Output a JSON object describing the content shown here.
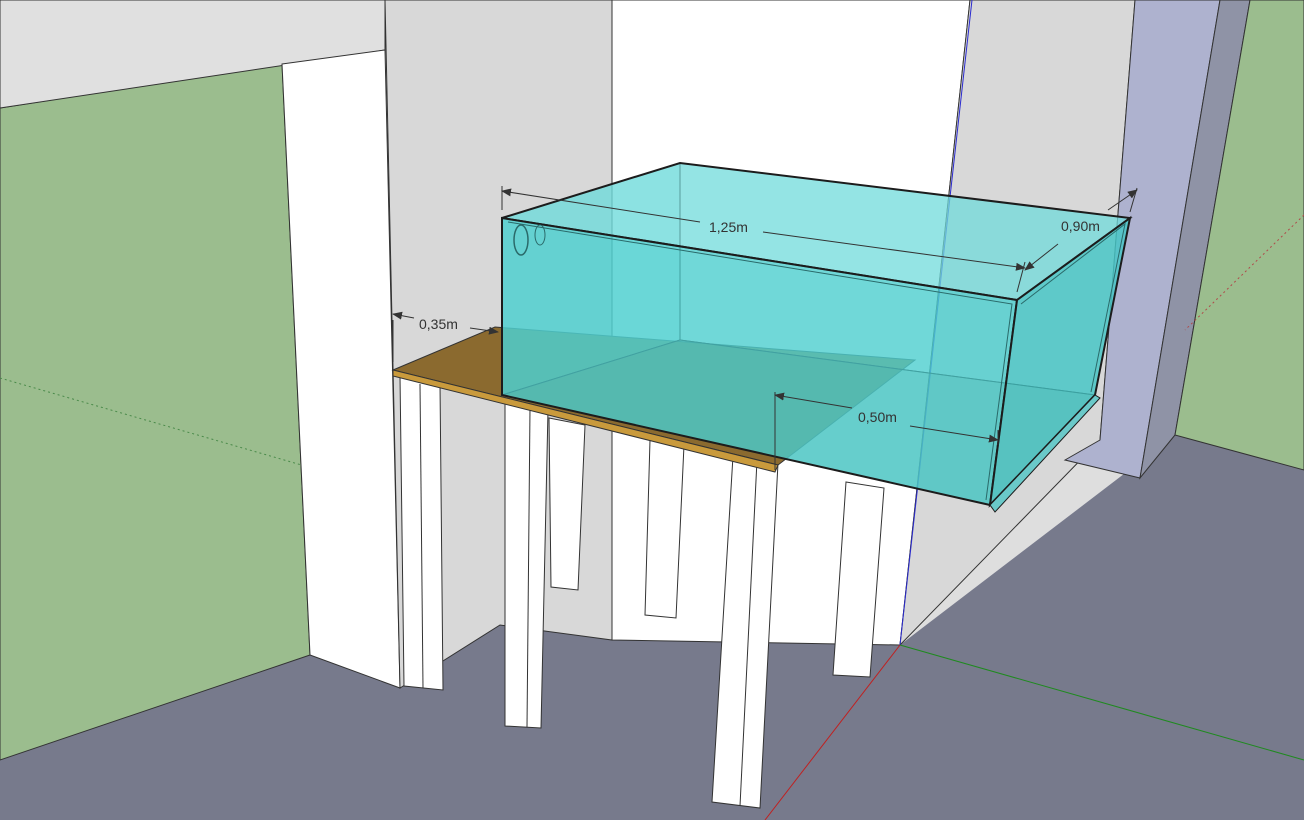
{
  "dimensions": {
    "length": "1,25m",
    "width": "0,90m",
    "gap": "0,35m",
    "height": "0,50m"
  },
  "colors": {
    "sky": "#e0e0e0",
    "left_wall": "#9bbd8e",
    "right_wall": "#9bbd8e",
    "floor": "#777a8c",
    "back_wall": "#dcdcdc",
    "white_wall": "#ffffff",
    "pillar": "#aeb2cf",
    "tabletop": "#8b6a2f",
    "glass": "#4ecfcf",
    "glass_edge": "#2a4a4a",
    "dimension_line": "#333333"
  }
}
